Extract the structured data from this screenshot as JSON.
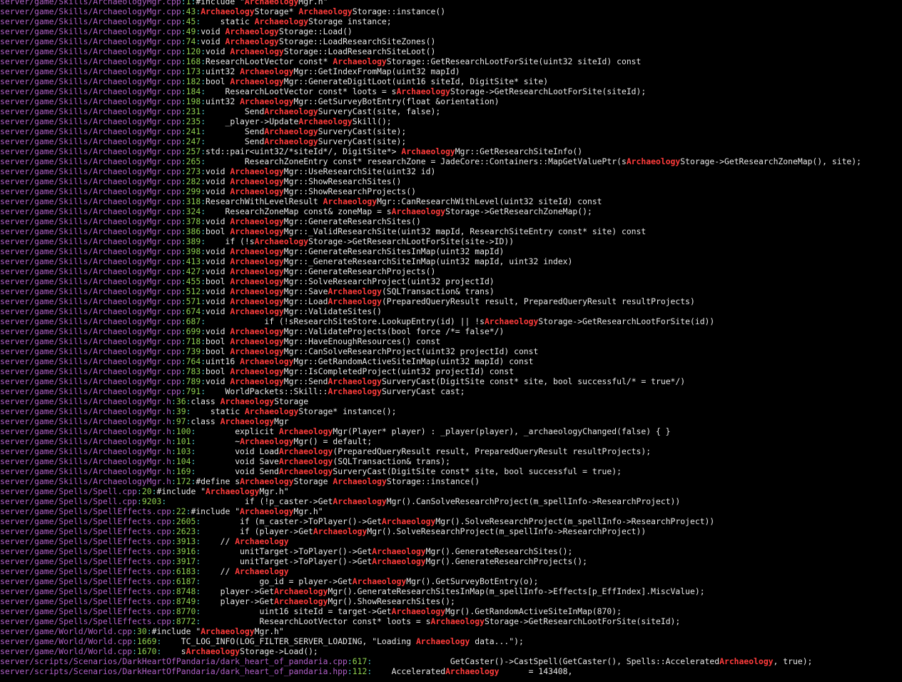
{
  "colors": {
    "background": "#000000",
    "text": "#e8e8e8",
    "path": "#b05fc8",
    "separator": "#4ec9c9",
    "line_number": "#8fd14f",
    "match": "#ff3b3b"
  },
  "search_term": "Archaeology",
  "lines": [
    {
      "file": "server/game/Skills/ArchaeologyMgr.cpp",
      "line": "1",
      "text": "#include \"ArchaeologyMgr.h\""
    },
    {
      "file": "server/game/Skills/ArchaeologyMgr.cpp",
      "line": "43",
      "text": "ArchaeologyStorage* ArchaeologyStorage::instance()"
    },
    {
      "file": "server/game/Skills/ArchaeologyMgr.cpp",
      "line": "45",
      "text": "    static ArchaeologyStorage instance;"
    },
    {
      "file": "server/game/Skills/ArchaeologyMgr.cpp",
      "line": "49",
      "text": "void ArchaeologyStorage::Load()"
    },
    {
      "file": "server/game/Skills/ArchaeologyMgr.cpp",
      "line": "74",
      "text": "void ArchaeologyStorage::LoadResearchSiteZones()"
    },
    {
      "file": "server/game/Skills/ArchaeologyMgr.cpp",
      "line": "120",
      "text": "void ArchaeologyStorage::LoadResearchSiteLoot()"
    },
    {
      "file": "server/game/Skills/ArchaeologyMgr.cpp",
      "line": "168",
      "text": "ResearchLootVector const* ArchaeologyStorage::GetResearchLootForSite(uint32 siteId) const"
    },
    {
      "file": "server/game/Skills/ArchaeologyMgr.cpp",
      "line": "173",
      "text": "uint32 ArchaeologyMgr::GetIndexFromMap(uint32 mapId)"
    },
    {
      "file": "server/game/Skills/ArchaeologyMgr.cpp",
      "line": "182",
      "text": "bool ArchaeologyMgr::GenerateDigitLoot(uint16 siteId, DigitSite* site)"
    },
    {
      "file": "server/game/Skills/ArchaeologyMgr.cpp",
      "line": "184",
      "text": "    ResearchLootVector const* loots = sArchaeologyStorage->GetResearchLootForSite(siteId);"
    },
    {
      "file": "server/game/Skills/ArchaeologyMgr.cpp",
      "line": "198",
      "text": "uint32 ArchaeologyMgr::GetSurveyBotEntry(float &orientation)"
    },
    {
      "file": "server/game/Skills/ArchaeologyMgr.cpp",
      "line": "231",
      "text": "        SendArchaeologySurveryCast(site, false);"
    },
    {
      "file": "server/game/Skills/ArchaeologyMgr.cpp",
      "line": "235",
      "text": "    _player->UpdateArchaeologySkill();"
    },
    {
      "file": "server/game/Skills/ArchaeologyMgr.cpp",
      "line": "241",
      "text": "        SendArchaeologySurveryCast(site);"
    },
    {
      "file": "server/game/Skills/ArchaeologyMgr.cpp",
      "line": "247",
      "text": "        SendArchaeologySurveryCast(site);"
    },
    {
      "file": "server/game/Skills/ArchaeologyMgr.cpp",
      "line": "257",
      "text": "std::pair<uint32/*siteId*/, DigitSite*> ArchaeologyMgr::GetResearchSiteInfo()"
    },
    {
      "file": "server/game/Skills/ArchaeologyMgr.cpp",
      "line": "265",
      "text": "        ResearchZoneEntry const* researchZone = JadeCore::Containers::MapGetValuePtr(sArchaeologyStorage->GetResearchZoneMap(), site);"
    },
    {
      "file": "server/game/Skills/ArchaeologyMgr.cpp",
      "line": "273",
      "text": "void ArchaeologyMgr::UseResearchSite(uint32 id)"
    },
    {
      "file": "server/game/Skills/ArchaeologyMgr.cpp",
      "line": "282",
      "text": "void ArchaeologyMgr::ShowResearchSites()"
    },
    {
      "file": "server/game/Skills/ArchaeologyMgr.cpp",
      "line": "299",
      "text": "void ArchaeologyMgr::ShowResearchProjects()"
    },
    {
      "file": "server/game/Skills/ArchaeologyMgr.cpp",
      "line": "318",
      "text": "ResearchWithLevelResult ArchaeologyMgr::CanResearchWithLevel(uint32 siteId) const"
    },
    {
      "file": "server/game/Skills/ArchaeologyMgr.cpp",
      "line": "324",
      "text": "    ResearchZoneMap const& zoneMap = sArchaeologyStorage->GetResearchZoneMap();"
    },
    {
      "file": "server/game/Skills/ArchaeologyMgr.cpp",
      "line": "378",
      "text": "void ArchaeologyMgr::GenerateResearchSites()"
    },
    {
      "file": "server/game/Skills/ArchaeologyMgr.cpp",
      "line": "386",
      "text": "bool ArchaeologyMgr::_ValidResearchSite(uint32 mapId, ResearchSiteEntry const* site) const"
    },
    {
      "file": "server/game/Skills/ArchaeologyMgr.cpp",
      "line": "389",
      "text": "    if (!sArchaeologyStorage->GetResearchLootForSite(site->ID))"
    },
    {
      "file": "server/game/Skills/ArchaeologyMgr.cpp",
      "line": "398",
      "text": "void ArchaeologyMgr::GenerateResearchSitesInMap(uint32 mapId)"
    },
    {
      "file": "server/game/Skills/ArchaeologyMgr.cpp",
      "line": "413",
      "text": "void ArchaeologyMgr::_GenerateResearchSiteInMap(uint32 mapId, uint32 index)"
    },
    {
      "file": "server/game/Skills/ArchaeologyMgr.cpp",
      "line": "427",
      "text": "void ArchaeologyMgr::GenerateResearchProjects()"
    },
    {
      "file": "server/game/Skills/ArchaeologyMgr.cpp",
      "line": "455",
      "text": "bool ArchaeologyMgr::SolveResearchProject(uint32 projectId)"
    },
    {
      "file": "server/game/Skills/ArchaeologyMgr.cpp",
      "line": "512",
      "text": "void ArchaeologyMgr::SaveArchaeology(SQLTransaction& trans)"
    },
    {
      "file": "server/game/Skills/ArchaeologyMgr.cpp",
      "line": "571",
      "text": "void ArchaeologyMgr::LoadArchaeology(PreparedQueryResult result, PreparedQueryResult resultProjects)"
    },
    {
      "file": "server/game/Skills/ArchaeologyMgr.cpp",
      "line": "674",
      "text": "void ArchaeologyMgr::ValidateSites()"
    },
    {
      "file": "server/game/Skills/ArchaeologyMgr.cpp",
      "line": "687",
      "text": "            if (!sResearchSiteStore.LookupEntry(id) || !sArchaeologyStorage->GetResearchLootForSite(id))"
    },
    {
      "file": "server/game/Skills/ArchaeologyMgr.cpp",
      "line": "699",
      "text": "void ArchaeologyMgr::ValidateProjects(bool force /*= false*/)"
    },
    {
      "file": "server/game/Skills/ArchaeologyMgr.cpp",
      "line": "718",
      "text": "bool ArchaeologyMgr::HaveEnoughResources() const"
    },
    {
      "file": "server/game/Skills/ArchaeologyMgr.cpp",
      "line": "739",
      "text": "bool ArchaeologyMgr::CanSolveResearchProject(uint32 projectId) const"
    },
    {
      "file": "server/game/Skills/ArchaeologyMgr.cpp",
      "line": "764",
      "text": "uint16 ArchaeologyMgr::GetRandomActiveSiteInMap(uint32 mapId) const"
    },
    {
      "file": "server/game/Skills/ArchaeologyMgr.cpp",
      "line": "783",
      "text": "bool ArchaeologyMgr::IsCompletedProject(uint32 projectId) const"
    },
    {
      "file": "server/game/Skills/ArchaeologyMgr.cpp",
      "line": "789",
      "text": "void ArchaeologyMgr::SendArchaeologySurveryCast(DigitSite const* site, bool successful/* = true*/)"
    },
    {
      "file": "server/game/Skills/ArchaeologyMgr.cpp",
      "line": "791",
      "text": "    WorldPackets::Skill::ArchaeologySurveryCast cast;"
    },
    {
      "file": "server/game/Skills/ArchaeologyMgr.h",
      "line": "36",
      "text": "class ArchaeologyStorage"
    },
    {
      "file": "server/game/Skills/ArchaeologyMgr.h",
      "line": "39",
      "text": "    static ArchaeologyStorage* instance();"
    },
    {
      "file": "server/game/Skills/ArchaeologyMgr.h",
      "line": "97",
      "text": "class ArchaeologyMgr"
    },
    {
      "file": "server/game/Skills/ArchaeologyMgr.h",
      "line": "100",
      "text": "        explicit ArchaeologyMgr(Player* player) : _player(player), _archaeologyChanged(false) { }"
    },
    {
      "file": "server/game/Skills/ArchaeologyMgr.h",
      "line": "101",
      "text": "        ~ArchaeologyMgr() = default;"
    },
    {
      "file": "server/game/Skills/ArchaeologyMgr.h",
      "line": "103",
      "text": "        void LoadArchaeology(PreparedQueryResult result, PreparedQueryResult resultProjects);"
    },
    {
      "file": "server/game/Skills/ArchaeologyMgr.h",
      "line": "104",
      "text": "        void SaveArchaeology(SQLTransaction& trans);"
    },
    {
      "file": "server/game/Skills/ArchaeologyMgr.h",
      "line": "169",
      "text": "        void SendArchaeologySurveryCast(DigitSite const* site, bool successful = true);"
    },
    {
      "file": "server/game/Skills/ArchaeologyMgr.h",
      "line": "172",
      "text": "#define sArchaeologyStorage ArchaeologyStorage::instance()"
    },
    {
      "file": "server/game/Spells/Spell.cpp",
      "line": "20",
      "text": "#include \"ArchaeologyMgr.h\""
    },
    {
      "file": "server/game/Spells/Spell.cpp",
      "line": "9203",
      "text": "                if (!p_caster->GetArchaeologyMgr().CanSolveResearchProject(m_spellInfo->ResearchProject))"
    },
    {
      "file": "server/game/Spells/SpellEffects.cpp",
      "line": "22",
      "text": "#include \"ArchaeologyMgr.h\""
    },
    {
      "file": "server/game/Spells/SpellEffects.cpp",
      "line": "2605",
      "text": "        if (m_caster->ToPlayer()->GetArchaeologyMgr().SolveResearchProject(m_spellInfo->ResearchProject))"
    },
    {
      "file": "server/game/Spells/SpellEffects.cpp",
      "line": "2623",
      "text": "        if (player->GetArchaeologyMgr().SolveResearchProject(m_spellInfo->ResearchProject))"
    },
    {
      "file": "server/game/Spells/SpellEffects.cpp",
      "line": "3913",
      "text": "    // Archaeology"
    },
    {
      "file": "server/game/Spells/SpellEffects.cpp",
      "line": "3916",
      "text": "        unitTarget->ToPlayer()->GetArchaeologyMgr().GenerateResearchSites();"
    },
    {
      "file": "server/game/Spells/SpellEffects.cpp",
      "line": "3917",
      "text": "        unitTarget->ToPlayer()->GetArchaeologyMgr().GenerateResearchProjects();"
    },
    {
      "file": "server/game/Spells/SpellEffects.cpp",
      "line": "6183",
      "text": "    // Archaeology"
    },
    {
      "file": "server/game/Spells/SpellEffects.cpp",
      "line": "6187",
      "text": "            go_id = player->GetArchaeologyMgr().GetSurveyBotEntry(o);"
    },
    {
      "file": "server/game/Spells/SpellEffects.cpp",
      "line": "8748",
      "text": "    player->GetArchaeologyMgr().GenerateResearchSitesInMap(m_spellInfo->Effects[p_EffIndex].MiscValue);"
    },
    {
      "file": "server/game/Spells/SpellEffects.cpp",
      "line": "8749",
      "text": "    player->GetArchaeologyMgr().ShowResearchSites();"
    },
    {
      "file": "server/game/Spells/SpellEffects.cpp",
      "line": "8770",
      "text": "            uint16 siteId = target->GetArchaeologyMgr().GetRandomActiveSiteInMap(870);"
    },
    {
      "file": "server/game/Spells/SpellEffects.cpp",
      "line": "8772",
      "text": "            ResearchLootVector const* loots = sArchaeologyStorage->GetResearchLootForSite(siteId);"
    },
    {
      "file": "server/game/World/World.cpp",
      "line": "30",
      "text": "#include \"ArchaeologyMgr.h\""
    },
    {
      "file": "server/game/World/World.cpp",
      "line": "1669",
      "text": "    TC_LOG_INFO(LOG_FILTER_SERVER_LOADING, \"Loading Archaeology data...\");"
    },
    {
      "file": "server/game/World/World.cpp",
      "line": "1670",
      "text": "    sArchaeologyStorage->Load();"
    },
    {
      "file": "server/scripts/Scenarios/DarkHeartOfPandaria/dark_heart_of_pandaria.cpp",
      "line": "617",
      "text": "                GetCaster()->CastSpell(GetCaster(), Spells::AcceleratedArchaeology, true);"
    },
    {
      "file": "server/scripts/Scenarios/DarkHeartOfPandaria/dark_heart_of_pandaria.hpp",
      "line": "112",
      "text": "    AcceleratedArchaeology      = 143408,"
    }
  ]
}
